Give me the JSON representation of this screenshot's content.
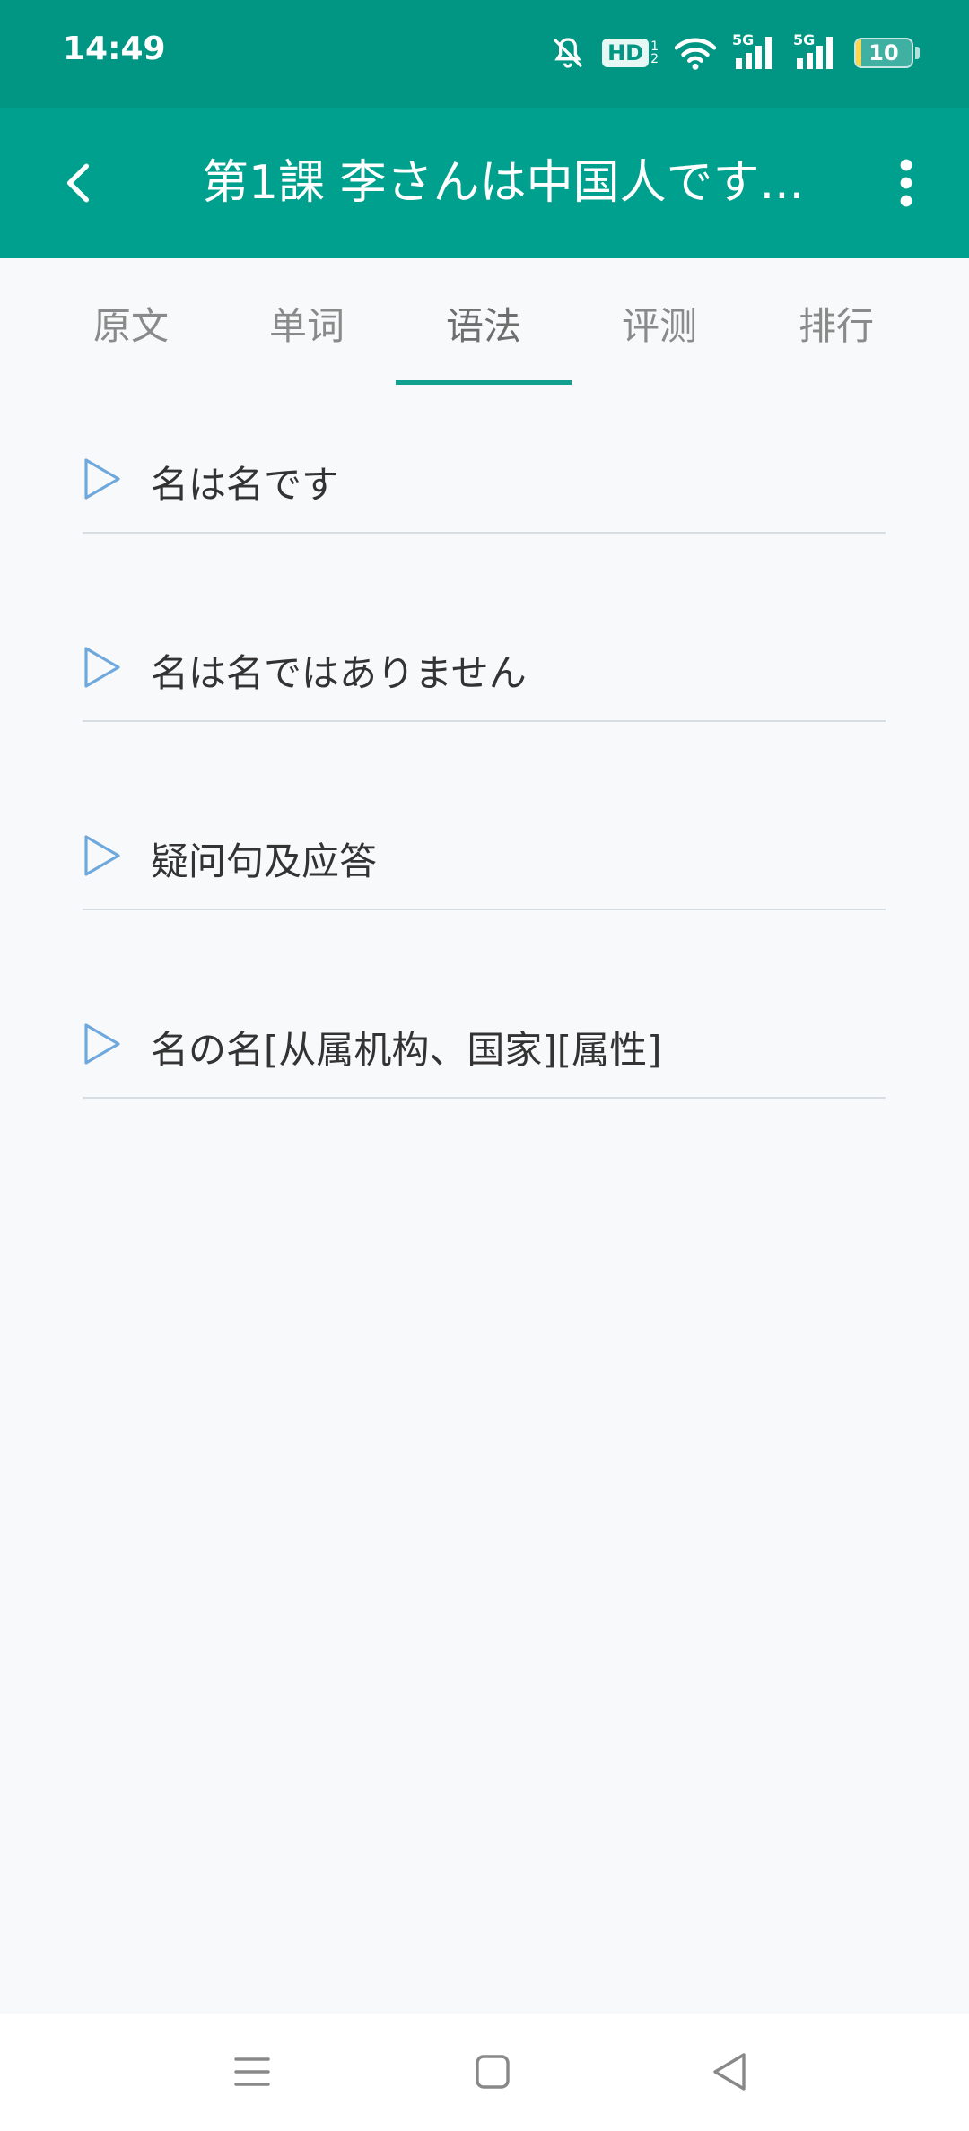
{
  "status_bar": {
    "time": "14:49",
    "icons": [
      "bell-off-icon",
      "hd-icon",
      "wifi-icon",
      "signal-5g-icon",
      "signal-5g-icon",
      "battery-icon"
    ],
    "hd_label": "HD",
    "hd_sub_top": "1",
    "hd_sub_bottom": "2",
    "net_label_1": "5G",
    "net_label_2": "5G",
    "battery_level": "10",
    "battery_fill_fraction": 0.1
  },
  "app_bar": {
    "title": "第1課 李さんは中国人です...",
    "back_icon": "chevron-left-icon",
    "more_icon": "more-vertical-icon",
    "background": "#00a08e"
  },
  "tabs": {
    "items": [
      {
        "label": "原文"
      },
      {
        "label": "单词"
      },
      {
        "label": "语法"
      },
      {
        "label": "评测"
      },
      {
        "label": "排行"
      }
    ],
    "selected": "语法",
    "indicator_color": "#11a08f"
  },
  "grammar_list": {
    "items": [
      {
        "label": "名は名です",
        "icon": "play-outline-icon"
      },
      {
        "label": "名は名ではありません",
        "icon": "play-outline-icon"
      },
      {
        "label": "疑问句及应答",
        "icon": "play-outline-icon"
      },
      {
        "label": "名の名[从属机构、国家][属性]",
        "icon": "play-outline-icon"
      }
    ],
    "icon_color": "#6fa8dc"
  },
  "nav_bar": {
    "buttons": [
      "menu-icon",
      "home-square-icon",
      "back-triangle-icon"
    ]
  }
}
